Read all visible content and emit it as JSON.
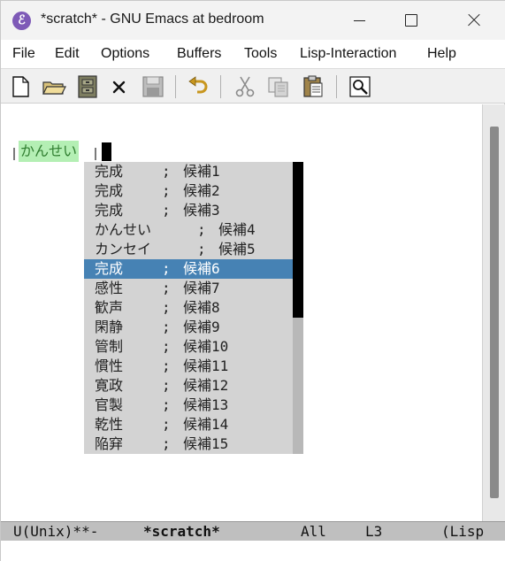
{
  "window": {
    "title": "*scratch* - GNU Emacs at bedroom",
    "icon": "emacs-icon"
  },
  "menubar": {
    "items": [
      "File",
      "Edit",
      "Options",
      "Buffers",
      "Tools",
      "Lisp-Interaction",
      "Help"
    ]
  },
  "toolbar": {
    "buttons": [
      "new-file-icon",
      "open-folder-icon",
      "dired-cabinet-icon",
      "kill-buffer-icon",
      "save-icon",
      "undo-icon",
      "cut-icon",
      "copy-icon",
      "paste-icon",
      "search-icon"
    ]
  },
  "buffer": {
    "preedit_text": "かんせい"
  },
  "completion": {
    "candidates": [
      {
        "word": "完成",
        "sep": ";",
        "annotation": "候補1"
      },
      {
        "word": "完成",
        "sep": ";",
        "annotation": "候補2"
      },
      {
        "word": "完成",
        "sep": ";",
        "annotation": "候補3"
      },
      {
        "word": "かんせい",
        "sep": ";",
        "annotation": "候補4"
      },
      {
        "word": "カンセイ",
        "sep": ";",
        "annotation": "候補5"
      },
      {
        "word": "完成",
        "sep": ";",
        "annotation": "候補6"
      },
      {
        "word": "感性",
        "sep": ";",
        "annotation": "候補7"
      },
      {
        "word": "歓声",
        "sep": ";",
        "annotation": "候補8"
      },
      {
        "word": "閑静",
        "sep": ";",
        "annotation": "候補9"
      },
      {
        "word": "管制",
        "sep": ";",
        "annotation": "候補10"
      },
      {
        "word": "慣性",
        "sep": ";",
        "annotation": "候補11"
      },
      {
        "word": "寛政",
        "sep": ";",
        "annotation": "候補12"
      },
      {
        "word": "官製",
        "sep": ";",
        "annotation": "候補13"
      },
      {
        "word": "乾性",
        "sep": ";",
        "annotation": "候補14"
      },
      {
        "word": "陥穽",
        "sep": ";",
        "annotation": "候補15"
      }
    ],
    "selected_index": 5,
    "selected_color": "#4682b4",
    "background_color": "#d3d3d3"
  },
  "modeline": {
    "coding": "U(Unix)**-",
    "buffer_name": "*scratch*",
    "position": "All",
    "line": "L3",
    "mode": "(Lisp"
  },
  "colors": {
    "preedit_background": "#b4efb4",
    "preedit_text": "#2f7d2f",
    "modeline_background": "#bfbfbf"
  }
}
